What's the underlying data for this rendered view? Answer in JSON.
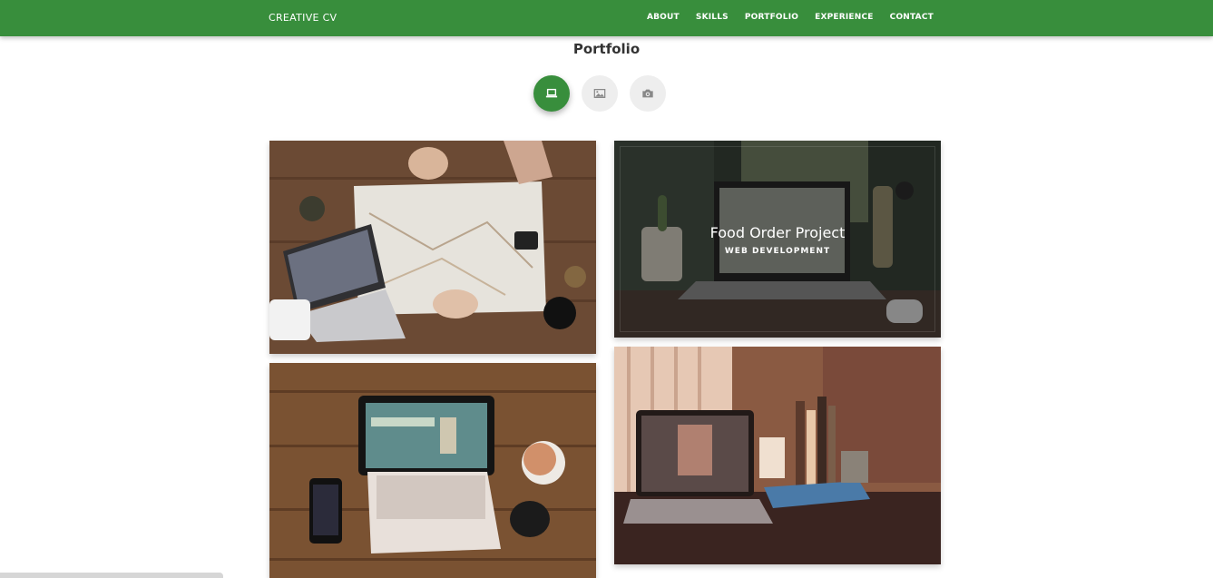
{
  "nav": {
    "brand": "CREATIVE CV",
    "links": [
      "ABOUT",
      "SKILLS",
      "PORTFOLIO",
      "EXPERIENCE",
      "CONTACT"
    ]
  },
  "portfolio": {
    "title": "Portfolio",
    "tabs": [
      {
        "icon": "laptop-icon",
        "active": true
      },
      {
        "icon": "image-icon",
        "active": false
      },
      {
        "icon": "camera-icon",
        "active": false
      }
    ],
    "hover_card": {
      "title": "Food Order Project",
      "subtitle": "WEB DEVELOPMENT"
    }
  },
  "colors": {
    "primary": "#388e3c",
    "tab_inactive": "#eeeeee"
  }
}
